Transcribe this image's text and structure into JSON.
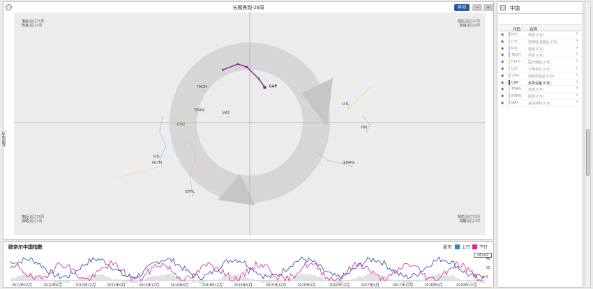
{
  "chart_panel": {
    "title": "长期表现-26周",
    "auto_label": "自动",
    "minus_label": "−",
    "plus_label": "+",
    "y_axis_label": "4周动力",
    "quadrants": {
      "top_left": {
        "line1": "落后",
        "line1_sub": "(超过26周",
        "line2": "改进",
        "line2_sub": "(超过4周"
      },
      "top_right": {
        "line1": "领先",
        "line1_sub": "(超过26周",
        "line2": "改进",
        "line2_sub": "(超过4周"
      },
      "bottom_left": {
        "line1": "落后",
        "line1_sub": "(超过26周",
        "line2": "减弱",
        "line2_sub": "(超过4周"
      },
      "bottom_right": {
        "line1": "领先",
        "line1_sub": "(超过26周",
        "line2": "减弱",
        "line2_sub": "(超过4周"
      }
    },
    "colors": {
      "active": "#8a1a96",
      "ring": "#d7d7d7",
      "plot_bg": "#ececec"
    }
  },
  "chart_data": {
    "type": "scatter",
    "title": "长期表现-26周",
    "ylabel": "4周动力",
    "series": [
      {
        "name": "CAP",
        "active": true,
        "color": "#8a1a96",
        "points": [
          [
            -0.09,
            0.18
          ],
          [
            -0.04,
            0.2
          ],
          [
            -0.01,
            0.19
          ],
          [
            0.03,
            0.15
          ],
          [
            0.05,
            0.12
          ]
        ]
      },
      {
        "name": "TECH",
        "color": "#b8b8b8",
        "points": [
          [
            -0.15,
            0.11
          ]
        ]
      },
      {
        "name": "RTL",
        "color": "#9ec3e6",
        "points": [
          [
            -0.29,
            0.02
          ],
          [
            -0.3,
            -0.03
          ],
          [
            -0.28,
            -0.08
          ],
          [
            -0.3,
            -0.13
          ]
        ]
      },
      {
        "name": "CYC",
        "color": "#cfe2b0",
        "points": [
          [
            -0.21,
            0.04
          ],
          [
            -0.2,
            0.01
          ],
          [
            -0.22,
            -0.02
          ]
        ]
      },
      {
        "name": "TRAN",
        "color": "#d9d9d9",
        "points": [
          [
            -0.16,
            0.03
          ]
        ]
      },
      {
        "name": "MAT",
        "color": "#e8c0a0",
        "points": [
          [
            -0.07,
            0.02
          ]
        ]
      },
      {
        "name": "UTL",
        "color": "#f3d77a",
        "points": [
          [
            0.4,
            0.12
          ],
          [
            0.36,
            0.08
          ],
          [
            0.33,
            0.05
          ]
        ]
      },
      {
        "name": "FIN",
        "color": "#9fd5c4",
        "points": [
          [
            0.38,
            0.02
          ],
          [
            0.4,
            -0.01
          ],
          [
            0.39,
            -0.03
          ]
        ]
      },
      {
        "name": "STPL",
        "color": "#f0b7c9",
        "points": [
          [
            -0.2,
            -0.06
          ],
          [
            -0.18,
            -0.12
          ],
          [
            -0.2,
            -0.18
          ],
          [
            -0.19,
            -0.25
          ]
        ]
      },
      {
        "name": "ENRG",
        "color": "#c9b7d8",
        "points": [
          [
            0.22,
            -0.1
          ],
          [
            0.26,
            -0.13
          ],
          [
            0.31,
            -0.14
          ],
          [
            0.34,
            -0.15
          ]
        ]
      },
      {
        "name": "HLTH",
        "color": "#f6d9a8",
        "points": [
          [
            -0.44,
            -0.19
          ],
          [
            -0.37,
            -0.17
          ],
          [
            -0.3,
            -0.15
          ]
        ]
      }
    ]
  },
  "index_panel": {
    "title": "欧奈尔中国指数",
    "legend_prefix": "股市:",
    "legend_up": "上行",
    "legend_down": "下行",
    "date_flag": "1月16日",
    "up_color": "#1f3fbf",
    "down_color": "#e01fa6",
    "x_ticks": [
      "2011年12月",
      "2012年6月",
      "2012年12月",
      "2013年6月",
      "2013年12月",
      "2014年6月",
      "2014年12月",
      "2015年6月",
      "2015年12月",
      "2016年6月",
      "2016年12月",
      "2017年6月",
      "2017年12月",
      "2018年6月",
      "2018年12月"
    ],
    "y_ticks": [
      "40",
      "20",
      "0"
    ]
  },
  "sidebar": {
    "region": "中国",
    "col_code": "代码",
    "col_name": "名称",
    "rows": [
      {
        "code": "RTL",
        "name": "零售 (CN)",
        "color": "#9ec3e6",
        "active": false
      },
      {
        "code": "CYC",
        "name": "周期性消费品 (CN)",
        "color": "#cfe2b0",
        "active": false
      },
      {
        "code": "FIN",
        "name": "金融 (CN)",
        "color": "#9fd5c4",
        "active": false
      },
      {
        "code": "TECH",
        "name": "科技 (CN)",
        "color": "#b8b8b8",
        "active": false
      },
      {
        "code": "HLTH",
        "name": "医疗保健 (CN)",
        "color": "#f6d9a8",
        "active": false
      },
      {
        "code": "UTL",
        "name": "公用事业 (CN)",
        "color": "#f3d77a",
        "active": false
      },
      {
        "code": "STPL",
        "name": "消费必需品 (CN)",
        "color": "#f0b7c9",
        "active": false
      },
      {
        "code": "CAP",
        "name": "资本设备 (CN)",
        "color": "#8a1a96",
        "active": true
      },
      {
        "code": "TRAN",
        "name": "运输 (CN)",
        "color": "#d9d9d9",
        "active": false
      },
      {
        "code": "ENRG",
        "name": "能源 (CN)",
        "color": "#c9b7d8",
        "active": false
      },
      {
        "code": "MAT",
        "name": "基本材料 (CN)",
        "color": "#e8c0a0",
        "active": false
      }
    ]
  }
}
